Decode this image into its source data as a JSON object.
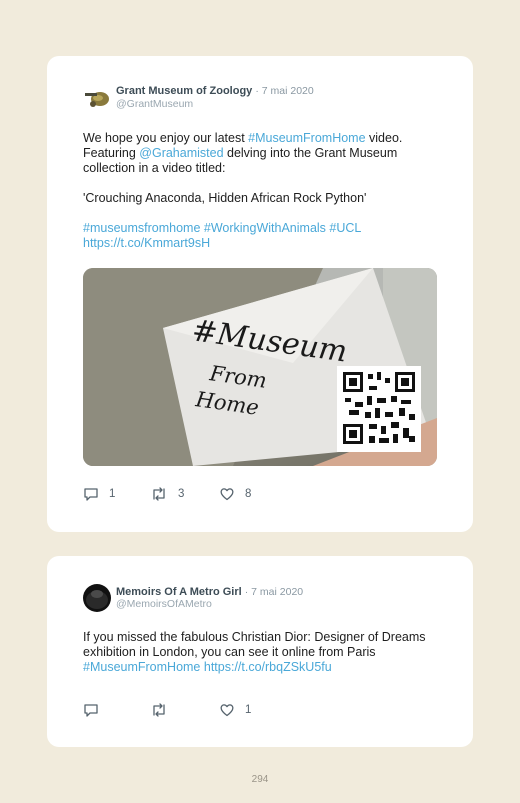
{
  "tweets": [
    {
      "name": "Grant Museum of Zoology",
      "date": "· 7 mai 2020",
      "handle": "@GrantMuseum",
      "text": {
        "t1": "We hope you enjoy our latest ",
        "l1": "#MuseumFromHome",
        "t2": " video. Featuring ",
        "l2": "@Grahamisted",
        "t3": " delving into the Grant Museum collection in a video titled:",
        "p2": "'Crouching Anaconda, Hidden African Rock Python'",
        "l3": "#museumsfromhome",
        "l4": "#WorkingWithAnimals",
        "l5": "#UCL",
        "l6": "https://t.co/Kmmart9sH"
      },
      "photo_note": {
        "line1": "#Museum",
        "line2": "From",
        "line3": "Home"
      },
      "replies": "1",
      "retweets": "3",
      "likes": "8"
    },
    {
      "name": "Memoirs Of A Metro Girl",
      "date": "· 7 mai 2020",
      "handle": "@MemoirsOfAMetro",
      "text": {
        "t1": "If you missed the fabulous Christian Dior: Designer of Dreams exhibition in London, you can see it online from Paris ",
        "l1": "#MuseumFromHome",
        "l2": "https://t.co/rbqZSkU5fu"
      },
      "replies": "",
      "retweets": "",
      "likes": "1"
    }
  ],
  "page_number": "294"
}
